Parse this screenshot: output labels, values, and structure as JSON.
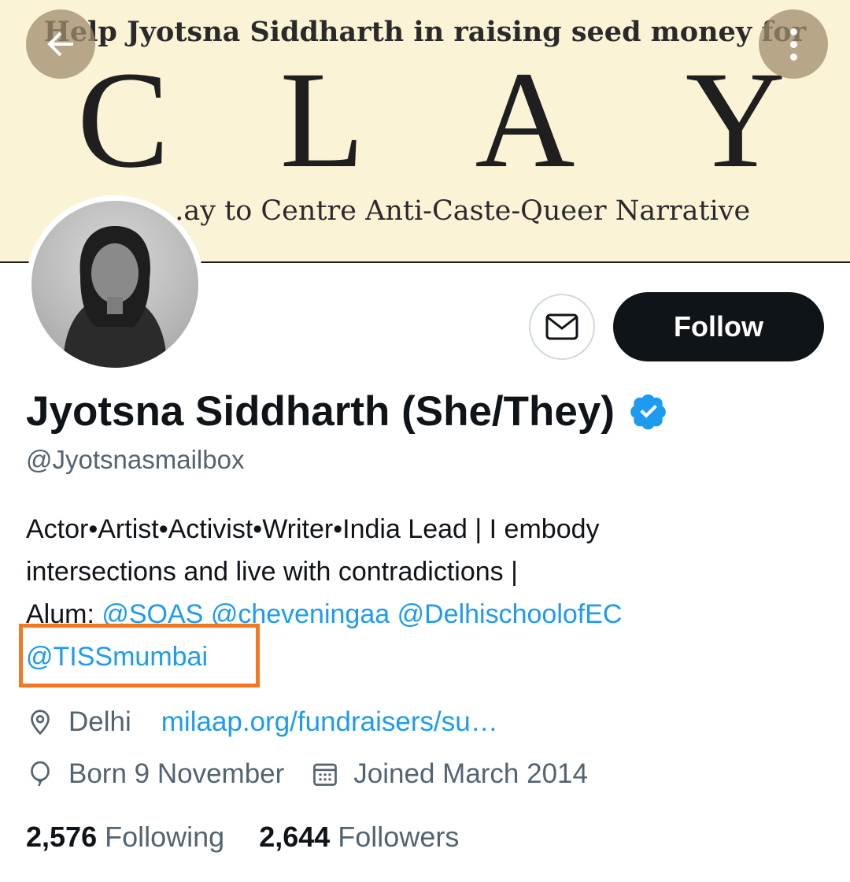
{
  "banner": {
    "top_text": "Help Jyotsna Siddharth in raising seed money for",
    "letters": [
      "C",
      "L",
      "A",
      "Y"
    ],
    "subtitle": "...ay to Centre Anti-Caste-Queer Narrative"
  },
  "nav": {
    "back_icon": "arrow-left-icon",
    "more_icon": "more-vertical-icon"
  },
  "profile": {
    "display_name": "Jyotsna Siddharth (She/They)",
    "verified_icon": "verified-badge-icon",
    "handle": "@Jyotsnasmailbox"
  },
  "actions": {
    "message_icon": "envelope-icon",
    "follow_label": "Follow"
  },
  "bio": {
    "line1": "Actor•Artist•Activist•Writer•India Lead | I embody",
    "line2": "intersections and live with contradictions |",
    "line3_prefix": "Alum: ",
    "mentions": [
      "@SOAS",
      "@cheveningaa",
      "@DelhischoolofEC",
      "@TISSmumbai"
    ]
  },
  "meta": {
    "location": "Delhi",
    "website": "milaap.org/fundraisers/su…",
    "birthday": "Born 9 November",
    "joined": "Joined March 2014"
  },
  "stats": {
    "following_count": "2,576",
    "following_label": "Following",
    "followers_count": "2,644",
    "followers_label": "Followers"
  },
  "colors": {
    "accent": "#1d9bf0",
    "highlight": "#f47721",
    "banner_bg": "#fbf3d6"
  }
}
